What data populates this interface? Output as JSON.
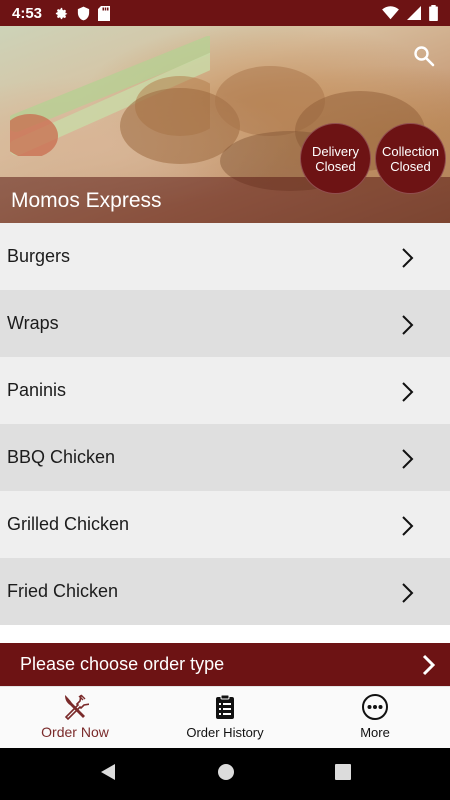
{
  "status_bar": {
    "time": "4:53",
    "left_icons": [
      "gear-icon",
      "shield-icon",
      "sd-card-icon"
    ],
    "right_icons": [
      "wifi-icon",
      "signal-icon",
      "battery-icon"
    ]
  },
  "hero": {
    "restaurant_name": "Momos Express",
    "delivery_line1": "Delivery",
    "delivery_line2": "Closed",
    "collection_line1": "Collection",
    "collection_line2": "Closed"
  },
  "categories": [
    {
      "label": "Burgers"
    },
    {
      "label": "Wraps"
    },
    {
      "label": "Paninis"
    },
    {
      "label": "BBQ Chicken"
    },
    {
      "label": "Grilled Chicken"
    },
    {
      "label": "Fried Chicken"
    }
  ],
  "order_type_bar": {
    "label": "Please choose order type"
  },
  "bottom_nav": {
    "items": [
      {
        "label": "Order Now",
        "icon": "fork-knife-icon",
        "active": true
      },
      {
        "label": "Order History",
        "icon": "clipboard-icon",
        "active": false
      },
      {
        "label": "More",
        "icon": "more-dots-icon",
        "active": false
      }
    ]
  },
  "colors": {
    "brand": "#6d1314",
    "active_nav": "#7a2a2a",
    "row_light": "#efefef",
    "row_dark": "#dfdfdf"
  }
}
